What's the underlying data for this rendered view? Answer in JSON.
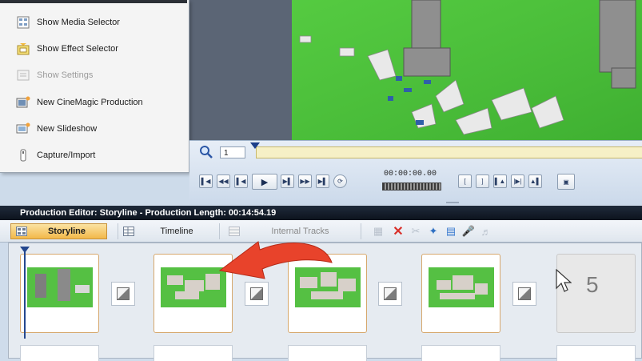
{
  "menu": {
    "items": [
      {
        "label": "Show Media Selector",
        "icon": "media-selector-icon",
        "enabled": true
      },
      {
        "label": "Show Effect Selector",
        "icon": "effect-selector-icon",
        "enabled": true
      },
      {
        "label": "Show Settings",
        "icon": "settings-icon",
        "enabled": false
      },
      {
        "label": "New CineMagic Production",
        "icon": "cinemagic-icon",
        "enabled": true
      },
      {
        "label": "New Slideshow",
        "icon": "slideshow-icon",
        "enabled": true
      },
      {
        "label": "Capture/Import",
        "icon": "capture-icon",
        "enabled": true
      }
    ]
  },
  "player": {
    "zoom_value": "1",
    "timecode": "00:00:00.00"
  },
  "editor": {
    "title": "Production Editor: Storyline - Production Length: 00:14:54.19",
    "tabs": [
      {
        "label": "Storyline",
        "active": true
      },
      {
        "label": "Timeline",
        "active": false
      },
      {
        "label": "Internal Tracks",
        "active": false
      }
    ],
    "empty_slot_number": "5"
  },
  "colors": {
    "accent_tab": "#f2b84a",
    "arrow": "#e8432b",
    "video_green": "#4fc63a",
    "delete_red": "#d9302a"
  }
}
